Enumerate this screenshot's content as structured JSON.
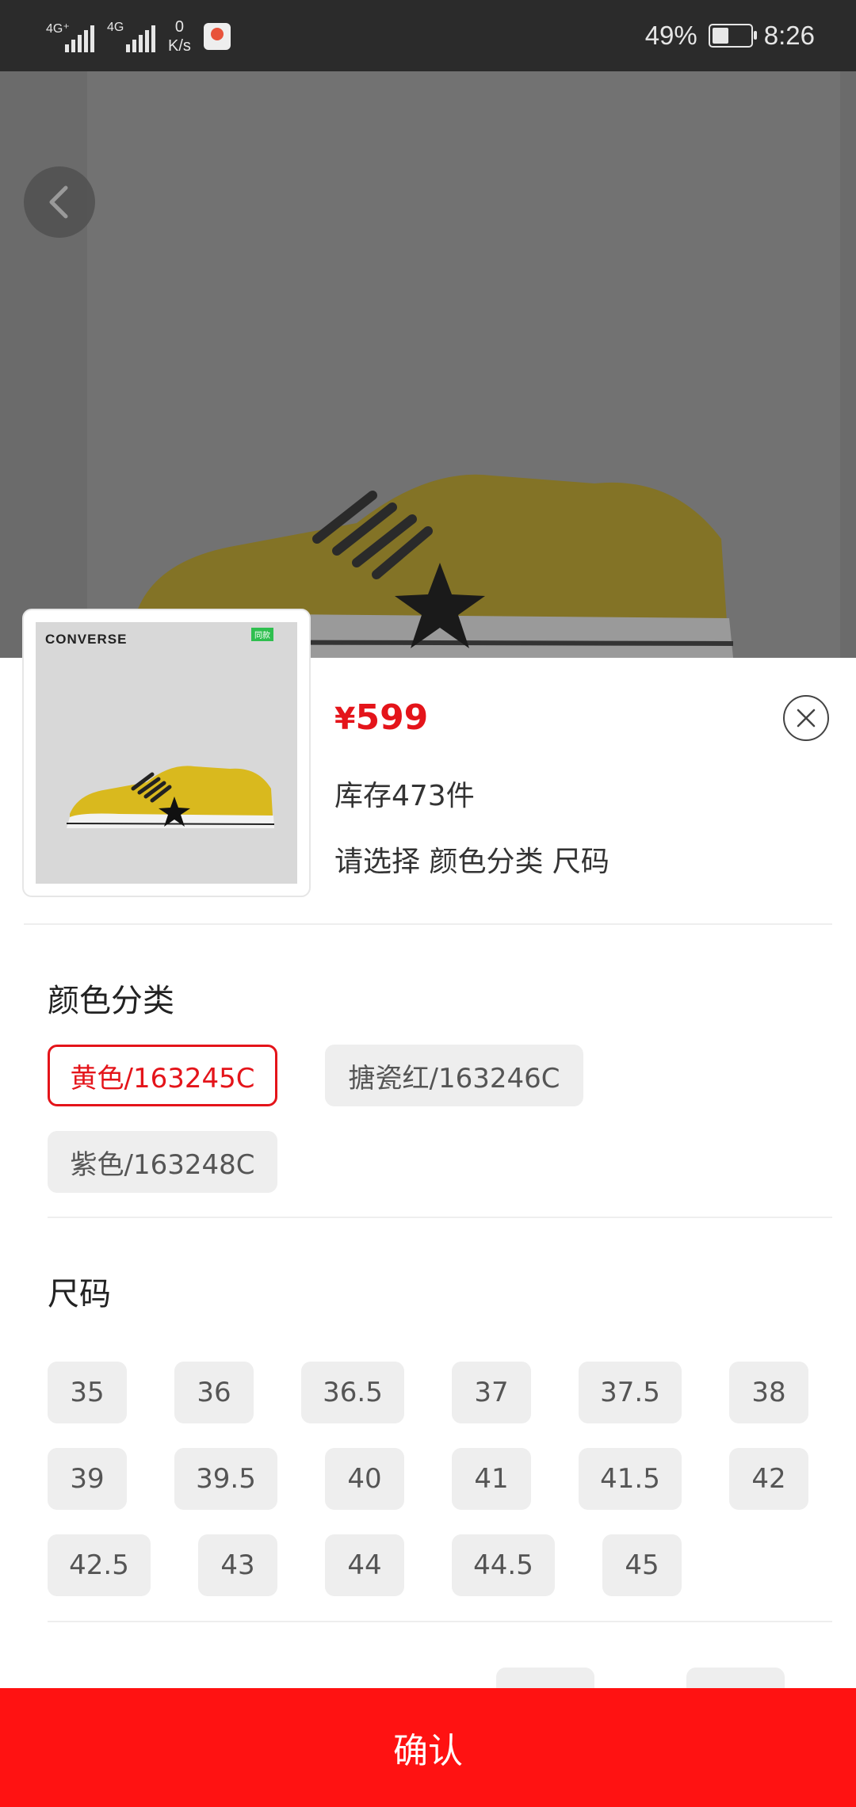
{
  "status_bar": {
    "signal1_label": "4G⁺",
    "signal2_label": "4G",
    "speed_value": "0",
    "speed_unit": "K/s",
    "battery_percent": "49%",
    "battery_level": 0.49,
    "time": "8:26"
  },
  "product": {
    "brand_logo": "CONVERSE",
    "thumb_badge": "同款",
    "currency": "¥",
    "price": "599",
    "stock_text": "库存473件",
    "select_hint": "请选择 颜色分类 尺码"
  },
  "color_section": {
    "title": "颜色分类",
    "options": [
      "黄色/163245C",
      "搪瓷红/163246C",
      "紫色/163248C"
    ],
    "selected": "黄色/163245C"
  },
  "size_section": {
    "title": "尺码",
    "options": [
      "35",
      "36",
      "36.5",
      "37",
      "37.5",
      "38",
      "39",
      "39.5",
      "40",
      "41",
      "41.5",
      "42",
      "42.5",
      "43",
      "44",
      "44.5",
      "45"
    ]
  },
  "footer": {
    "confirm_label": "确认"
  },
  "colors": {
    "accent": "#e4141a",
    "confirm_bg": "#ff1212",
    "shoe_yellow": "#d9b91e"
  },
  "icons": {
    "back": "back-arrow-icon",
    "close": "close-circle-icon"
  }
}
